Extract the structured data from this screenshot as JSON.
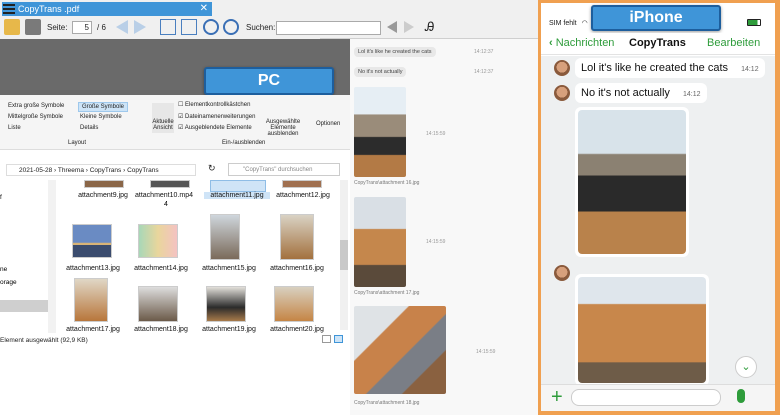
{
  "pdf": {
    "tab_title": "CopyTrans .pdf",
    "page_label": "Seite:",
    "page_current": "5",
    "page_total": "/ 6",
    "search_label": "Suchen:"
  },
  "badges": {
    "pc": "PC",
    "iphone": "iPhone"
  },
  "ribbon": {
    "view_items": [
      "Extra große Symbole",
      "Mittelgroße Symbole",
      "Liste"
    ],
    "view_items2": [
      "Große Symbole",
      "Kleine Symbole",
      "Details"
    ],
    "group_layout": "Layout",
    "current_view": "Aktuelle Ansicht",
    "checkboxes": [
      "Elementkontrollkästchen",
      "Dateinamenerweiterungen",
      "Ausgeblendete Elemente"
    ],
    "hide_selected": "Ausgewählte Elemente ausblenden",
    "options": "Optionen",
    "group_showhide": "Ein-/ausblenden"
  },
  "address": {
    "crumbs": [
      "2021-05-28",
      "Threema",
      "CopyTrans",
      "CopyTrans"
    ],
    "search_placeholder": "\"CopyTrans\" durchsuchen"
  },
  "navpane": [
    "f",
    "ne",
    "orage"
  ],
  "files": {
    "row1": [
      "attachment9.jpg",
      "attachment10.mp4",
      "attachment11.jpg",
      "attachment12.jpg"
    ],
    "row2": [
      "attachment13.jpg",
      "attachment14.jpg",
      "attachment15.jpg",
      "attachment16.jpg"
    ],
    "row3": [
      "attachment17.jpg",
      "attachment18.jpg",
      "attachment19.jpg",
      "attachment20.jpg"
    ]
  },
  "status": "Element ausgewählt (92,9 KB)",
  "desk_chat": {
    "msg1": "Lol it's like he created the cats",
    "time1": "14:12:37",
    "msg2": "No it's not actually",
    "time2": "14:12:37",
    "photo_time1": "14:15:59",
    "caption1": "CopyTrans\\attachment 16.jpg",
    "photo_time2": "14:15:59",
    "caption2": "CopyTrans\\attachment 17.jpg",
    "photo_time3": "14:15:59",
    "caption3": "CopyTrans\\attachment 18.jpg"
  },
  "phone": {
    "status_left": "SIM fehlt",
    "status_time": "",
    "back_label": "Nachrichten",
    "title": "CopyTrans",
    "edit_label": "Bearbeiten",
    "msg1": "Lol it's like he created the cats",
    "time1": "14:12",
    "msg2": "No it's not actually",
    "time2": "14:12"
  },
  "colors": {
    "accent": "#3f95d8",
    "frame": "#f0a050",
    "green": "#2e9c3b"
  }
}
